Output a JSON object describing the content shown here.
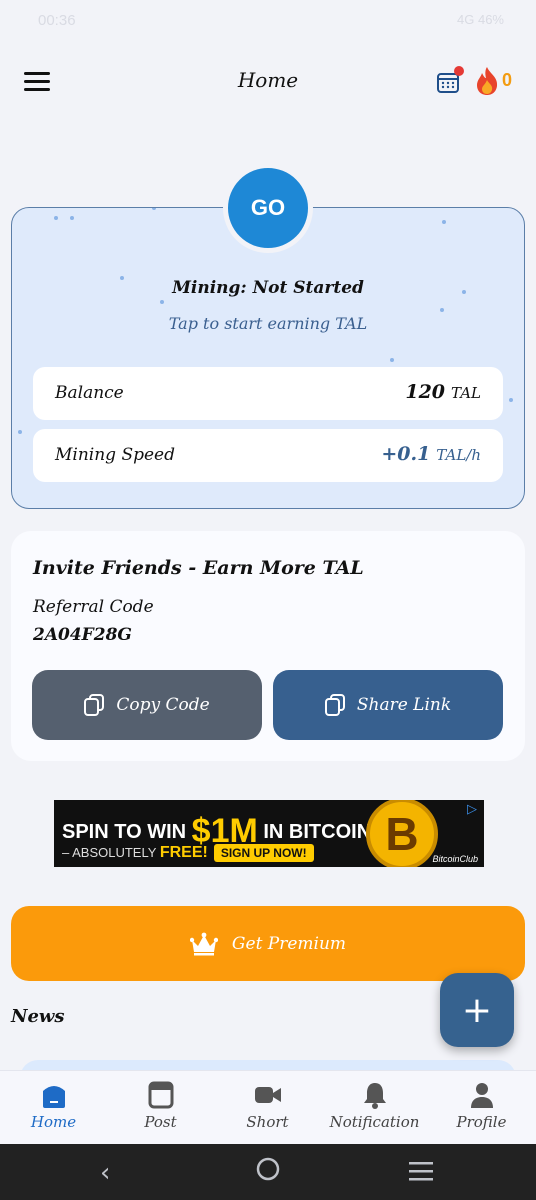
{
  "status_bar": {
    "time": "00:36",
    "right": "4G 46%"
  },
  "app_bar": {
    "title": "Home",
    "streak_count": "0"
  },
  "mining": {
    "go_label": "GO",
    "status": "Mining: Not Started",
    "hint": "Tap to start earning TAL",
    "balance_label": "Balance",
    "balance_value": "120",
    "balance_unit": "TAL",
    "speed_label": "Mining Speed",
    "speed_value": "+0.1",
    "speed_unit": "TAL/h"
  },
  "invite": {
    "title": "Invite Friends - Earn More TAL",
    "referral_label": "Referral Code",
    "referral_code": "2A04F28G",
    "copy_label": "Copy Code",
    "share_label": "Share Link"
  },
  "ad": {
    "line1_a": "SPIN TO WIN",
    "line1_big": "$1M",
    "line1_b": "IN BITCOIN",
    "line2_a": "– ABSOLUTELY",
    "line2_b": "FREE!",
    "cta": "SIGN UP NOW!",
    "coin_symbol": "B",
    "brand": "BitcoinClub"
  },
  "premium_label": "Get Premium",
  "news_label": "News",
  "fab_label": "+",
  "bottom_nav": [
    {
      "label": "Home",
      "icon": "home-icon",
      "active": true
    },
    {
      "label": "Post",
      "icon": "post-icon"
    },
    {
      "label": "Short",
      "icon": "video-icon"
    },
    {
      "label": "Notification",
      "icon": "bell-icon"
    },
    {
      "label": "Profile",
      "icon": "person-icon"
    }
  ],
  "colors": {
    "accent": "#1e88d6",
    "primary_dark": "#37608f",
    "premium": "#fb9a0b",
    "active_nav": "#1e6bc6"
  }
}
